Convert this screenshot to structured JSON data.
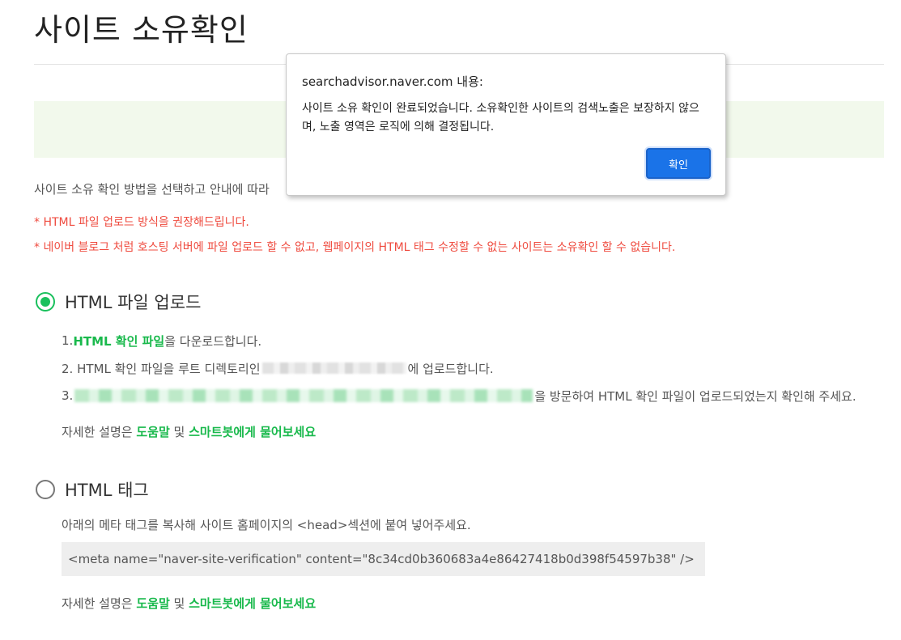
{
  "page": {
    "title": "사이트 소유확인",
    "instruction": "사이트 소유 확인 방법을 선택하고 안내에 따라",
    "warnings": [
      "* HTML 파일 업로드 방식을 권장해드립니다.",
      "* 네이버 블로그 처럼 호스팅 서버에 파일 업로드 할 수 없고, 웹페이지의 HTML 태그 수정할 수 없는 사이트는 소유확인 할 수 없습니다."
    ]
  },
  "methods": {
    "html_file": {
      "label": "HTML 파일 업로드",
      "selected": true,
      "steps": {
        "s1_prefix": "1. ",
        "s1_link": "HTML 확인 파일",
        "s1_suffix": "을 다운로드합니다.",
        "s2_prefix": "2. HTML 확인 파일을 루트 디렉토리인",
        "s2_suffix": "에 업로드합니다.",
        "s3_prefix": "3.",
        "s3_suffix": "을 방문하여 HTML 확인 파일이 업로드되었는지 확인해 주세요."
      },
      "help": {
        "prefix": "자세한 설명은 ",
        "link1": "도움말",
        "middle": " 및 ",
        "link2": "스마트봇에게 물어보세요"
      }
    },
    "html_tag": {
      "label": "HTML 태그",
      "selected": false,
      "description": "아래의 메타 태그를 복사해 사이트 홈페이지의 <head>섹션에 붙여 넣어주세요.",
      "meta_tag": "<meta name=\"naver-site-verification\" content=\"8c34cd0b360683a4e86427418b0d398f54597b38\" />",
      "help": {
        "prefix": "자세한 설명은 ",
        "link1": "도움말",
        "middle": " 및 ",
        "link2": "스마트봇에게 물어보세요"
      }
    }
  },
  "dialog": {
    "origin": "searchadvisor.naver.com 내용:",
    "message": "사이트 소유 확인이 완료되었습니다. 소유확인한 사이트의 검색노출은 보장하지 않으며, 노출 영역은 로직에 의해 결정됩니다.",
    "ok_label": "확인"
  },
  "colors": {
    "accent_green": "#19c05c",
    "warning_red": "#ef4b3f",
    "dialog_button_blue": "#1a73e8"
  }
}
